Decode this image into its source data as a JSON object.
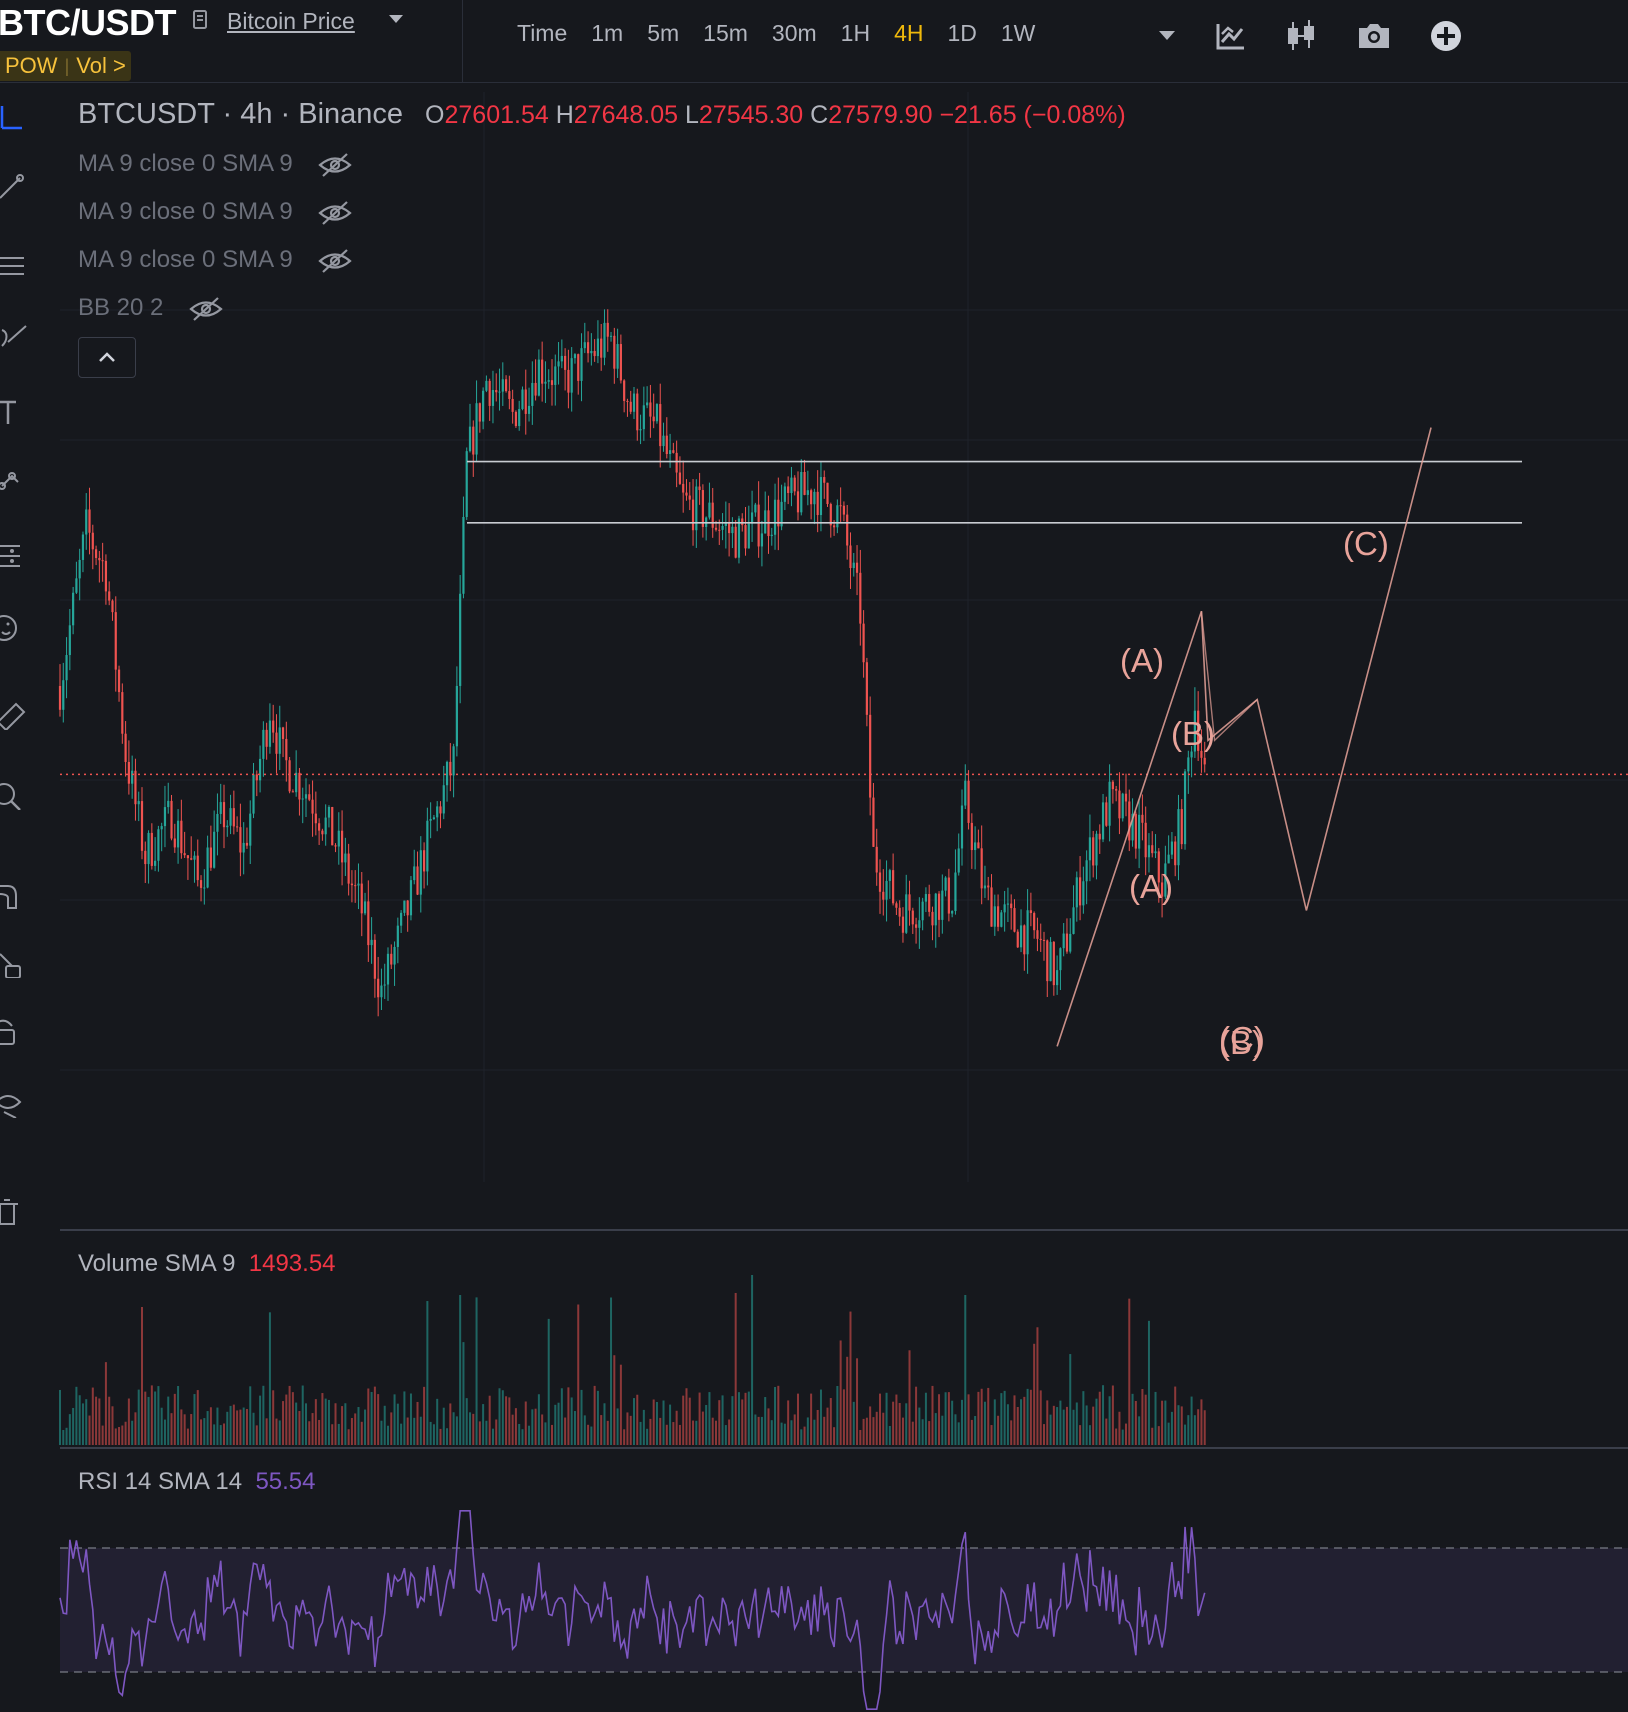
{
  "header": {
    "symbol": "BTC/USDT",
    "link": "Bitcoin Price",
    "tags": [
      "POW",
      "Vol >"
    ],
    "timeframes": [
      "Time",
      "1m",
      "5m",
      "15m",
      "30m",
      "1H",
      "4H",
      "1D",
      "1W"
    ],
    "active_timeframe": "4H",
    "icons": [
      "dropdown-icon",
      "indicators-icon",
      "candle-style-icon",
      "camera-icon",
      "add-icon"
    ]
  },
  "legend": {
    "ticker": "BTCUSDT",
    "interval": "4h",
    "exchange": "Binance",
    "o_label": "O",
    "open": "27601.54",
    "h_label": "H",
    "high": "27648.05",
    "l_label": "L",
    "low": "27545.30",
    "c_label": "C",
    "close": "27579.90",
    "change": "−21.65 (−0.08%)"
  },
  "indicators": [
    {
      "label": "MA 9 close 0 SMA 9"
    },
    {
      "label": "MA 9 close 0 SMA 9"
    },
    {
      "label": "MA 9 close 0 SMA 9"
    },
    {
      "label": "BB 20 2"
    }
  ],
  "volume_pane": {
    "label": "Volume SMA 9",
    "value": "1493.54"
  },
  "rsi_pane": {
    "label": "RSI 14 SMA 14",
    "value": "55.54"
  },
  "wave_labels": [
    "(A)",
    "(B)",
    "(C)",
    "(A)",
    "(B)",
    "(C)"
  ],
  "colors": {
    "up": "#26a69a",
    "down": "#ef5350",
    "accent": "#f0b90b",
    "wave": "#e8a39a",
    "rsi": "#7e57c2"
  },
  "chart_data": {
    "type": "candlestick",
    "symbol": "BTCUSDT",
    "interval": "4h",
    "last_bar": {
      "open": 27601.54,
      "high": 27648.05,
      "low": 27545.3,
      "close": 27579.9
    },
    "price_path": [
      {
        "i": 0,
        "p": 0.55
      },
      {
        "i": 8,
        "p": 0.78
      },
      {
        "i": 14,
        "p": 0.72
      },
      {
        "i": 20,
        "p": 0.45
      },
      {
        "i": 26,
        "p": 0.3
      },
      {
        "i": 34,
        "p": 0.36
      },
      {
        "i": 42,
        "p": 0.26
      },
      {
        "i": 50,
        "p": 0.36
      },
      {
        "i": 56,
        "p": 0.31
      },
      {
        "i": 64,
        "p": 0.52
      },
      {
        "i": 68,
        "p": 0.44
      },
      {
        "i": 76,
        "p": 0.39
      },
      {
        "i": 84,
        "p": 0.32
      },
      {
        "i": 92,
        "p": 0.22
      },
      {
        "i": 98,
        "p": 0.1
      },
      {
        "i": 106,
        "p": 0.22
      },
      {
        "i": 112,
        "p": 0.32
      },
      {
        "i": 120,
        "p": 0.44
      },
      {
        "i": 124,
        "p": 0.88
      },
      {
        "i": 130,
        "p": 1.0
      },
      {
        "i": 138,
        "p": 0.95
      },
      {
        "i": 146,
        "p": 1.02
      },
      {
        "i": 154,
        "p": 1.0
      },
      {
        "i": 162,
        "p": 1.04
      },
      {
        "i": 168,
        "p": 1.06
      },
      {
        "i": 174,
        "p": 0.96
      },
      {
        "i": 182,
        "p": 0.93
      },
      {
        "i": 190,
        "p": 0.82
      },
      {
        "i": 198,
        "p": 0.8
      },
      {
        "i": 206,
        "p": 0.77
      },
      {
        "i": 214,
        "p": 0.79
      },
      {
        "i": 222,
        "p": 0.82
      },
      {
        "i": 230,
        "p": 0.84
      },
      {
        "i": 238,
        "p": 0.8
      },
      {
        "i": 244,
        "p": 0.66
      },
      {
        "i": 248,
        "p": 0.3
      },
      {
        "i": 256,
        "p": 0.22
      },
      {
        "i": 264,
        "p": 0.23
      },
      {
        "i": 272,
        "p": 0.24
      },
      {
        "i": 276,
        "p": 0.38
      },
      {
        "i": 282,
        "p": 0.24
      },
      {
        "i": 290,
        "p": 0.2
      },
      {
        "i": 298,
        "p": 0.18
      },
      {
        "i": 304,
        "p": 0.12
      },
      {
        "i": 312,
        "p": 0.28
      },
      {
        "i": 320,
        "p": 0.38
      },
      {
        "i": 328,
        "p": 0.34
      },
      {
        "i": 336,
        "p": 0.26
      },
      {
        "i": 342,
        "p": 0.35
      },
      {
        "i": 346,
        "p": 0.52
      },
      {
        "i": 349,
        "p": 0.42
      }
    ],
    "horizontal_lines": [
      {
        "style": "solid",
        "p": 0.88
      },
      {
        "style": "solid",
        "p": 0.79
      },
      {
        "style": "dotted-current",
        "p": 0.42
      }
    ],
    "wave_projection": [
      {
        "label": "",
        "i": 304,
        "p": 0.02
      },
      {
        "label": "(A)",
        "i": 348,
        "p": 0.66
      },
      {
        "label": "(B)",
        "i": 350,
        "p": 0.47
      },
      {
        "label": "",
        "i": 365,
        "p": 0.53
      },
      {
        "label": "(C)/(B)",
        "i": 380,
        "p": 0.22
      },
      {
        "label": "(C)",
        "i": 418,
        "p": 0.93
      }
    ],
    "rsi": {
      "overbought": 70,
      "oversold": 30,
      "last": 55.54
    },
    "volume": {
      "sma9": 1493.54
    }
  }
}
